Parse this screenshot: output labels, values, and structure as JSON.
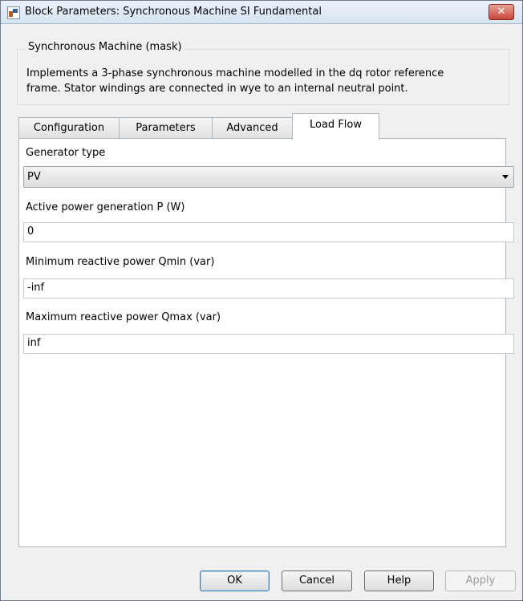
{
  "window": {
    "title": "Block Parameters: Synchronous Machine SI Fundamental",
    "close_glyph": "✕"
  },
  "mask": {
    "title": "Synchronous Machine (mask)",
    "description_lines": [
      "Implements a 3-phase synchronous machine modelled in the dq rotor reference",
      "frame. Stator windings are connected in wye to an internal neutral point."
    ]
  },
  "tabs": [
    {
      "label": "Configuration",
      "active": false
    },
    {
      "label": "Parameters",
      "active": false
    },
    {
      "label": "Advanced",
      "active": false
    },
    {
      "label": "Load Flow",
      "active": true
    }
  ],
  "load_flow": {
    "generator_type": {
      "label": "Generator type",
      "value": "PV"
    },
    "active_power": {
      "label": "Active power generation P (W)",
      "value": "0"
    },
    "qmin": {
      "label": "Minimum reactive power Qmin (var)",
      "value": "-inf"
    },
    "qmax": {
      "label": "Maximum reactive power Qmax (var)",
      "value": "inf"
    }
  },
  "buttons": {
    "ok": "OK",
    "cancel": "Cancel",
    "help": "Help",
    "apply": "Apply"
  },
  "icons": {
    "app": "simulink-block-icon",
    "close": "close-icon",
    "dropdown": "chevron-down-icon"
  }
}
